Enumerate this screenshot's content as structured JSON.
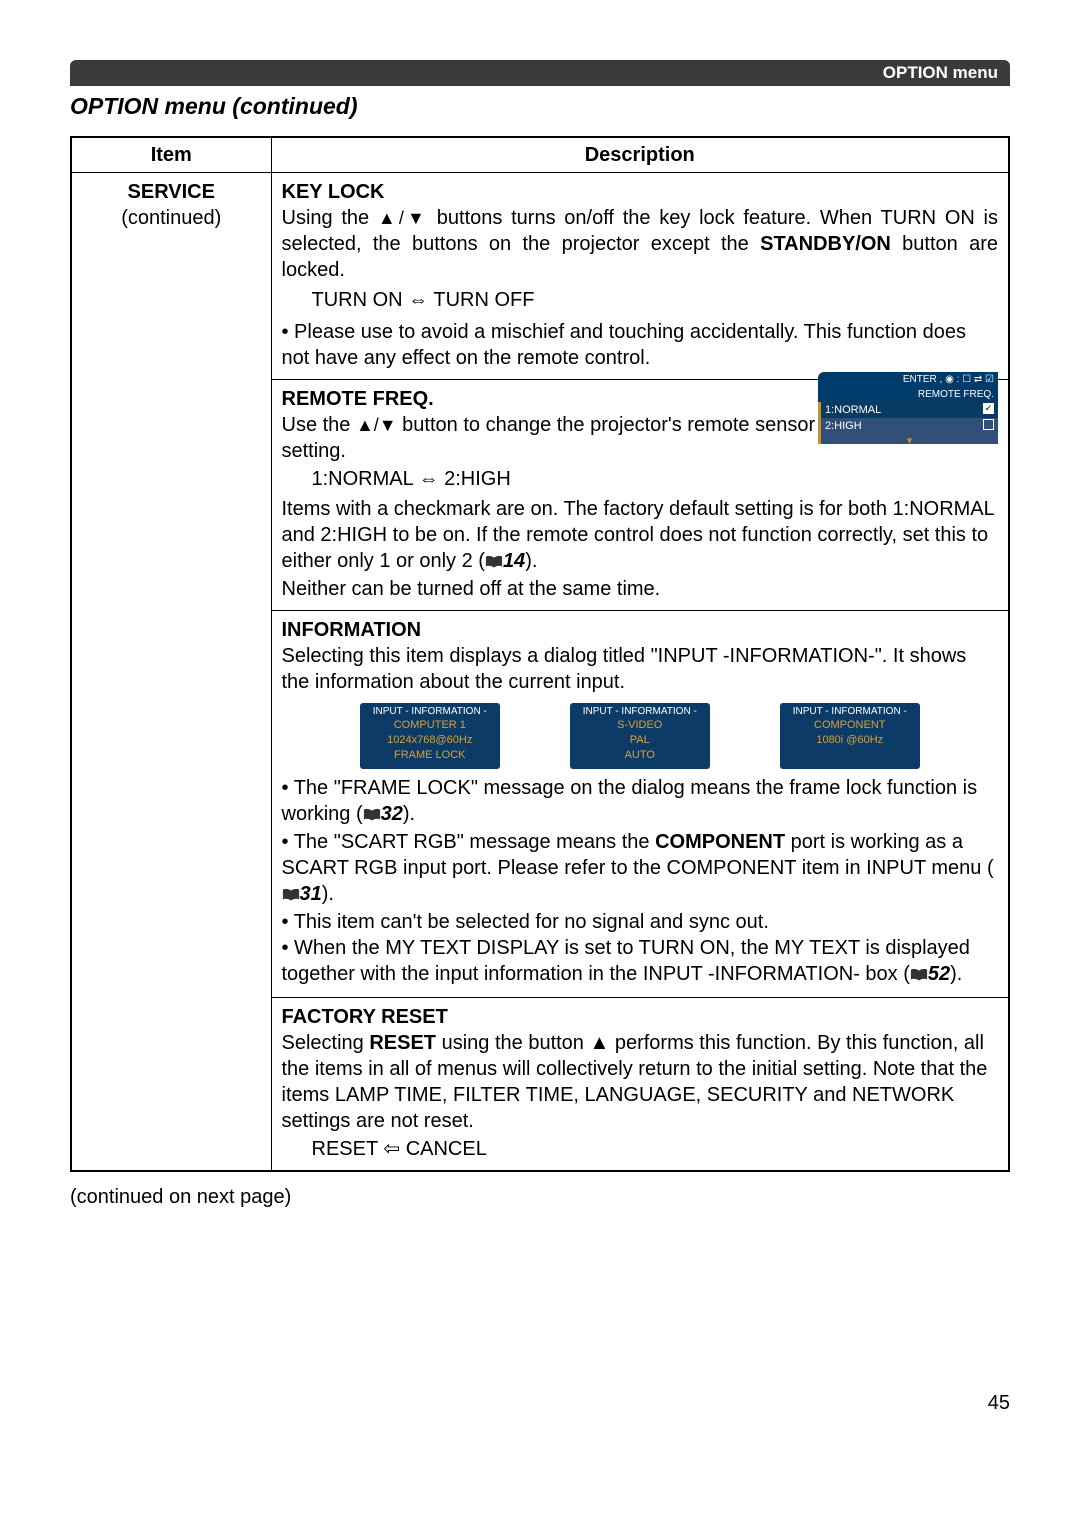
{
  "header": {
    "breadcrumb": "OPTION menu"
  },
  "page": {
    "title": "OPTION menu (continued)",
    "continued_note": "(continued on next page)",
    "number": "45"
  },
  "table": {
    "head_item": "Item",
    "head_desc": "Description",
    "item_label_1": "SERVICE",
    "item_label_2": "(continued)"
  },
  "keylock": {
    "title": "KEY LOCK",
    "p1a": "Using  the  ",
    "p1b": "  buttons  turns  on/off  the  key  lock  feature.  When TURN ON is selected, the buttons on the projector except the ",
    "p1c": "STANDBY/ON",
    "p1d": " button are locked.",
    "toggle_a": "TURN ON ",
    "toggle_b": " TURN OFF",
    "bullet": "• Please use to avoid a mischief and touching accidentally. This function does not have any effect on the remote control."
  },
  "remotefreq": {
    "title": "REMOTE FREQ.",
    "p1a": "Use the ",
    "p1b": " button to change the projector's remote sensor setting.",
    "toggle_a": "1:NORMAL ",
    "toggle_b": " 2:HIGH",
    "p2a": "Items with a checkmark are on. The factory default setting is for both 1:NORMAL and 2:HIGH to be on.  If the remote control does not function correctly, set this to either only 1 or only 2 (",
    "ref": "14",
    "p2b": ").",
    "p3": "Neither can be turned off at the same time.",
    "osd": {
      "hdr": "ENTER , ◉ : ☐ ⇄ ☑",
      "sub": "REMOTE FREQ.",
      "opt1": "1:NORMAL",
      "opt2": "2:HIGH"
    }
  },
  "information": {
    "title": "INFORMATION",
    "p1": "Selecting this item displays a dialog titled \"INPUT -INFORMATION-\". It shows the information about the current input.",
    "boxes": [
      {
        "t": "INPUT - INFORMATION -",
        "p1": "COMPUTER 1",
        "p2": "1024x768@60Hz",
        "p3": "FRAME LOCK"
      },
      {
        "t": "INPUT - INFORMATION -",
        "p1": "S-VIDEO",
        "p2": "PAL",
        "p3": "AUTO"
      },
      {
        "t": "INPUT - INFORMATION -",
        "p1": "COMPONENT",
        "p2": "1080i @60Hz",
        "p3": ""
      }
    ],
    "b1a": "• The \"FRAME LOCK\" message on the dialog means the frame lock function is working (",
    "ref1": "32",
    "b1b": ").",
    "b2a": "• The \"SCART RGB\" message means the ",
    "b2bold": "COMPONENT",
    "b2b": " port is working as a SCART RGB input port. Please refer to the COMPONENT item in INPUT menu (",
    "ref2": "31",
    "b2c": ").",
    "b3": "• This item can't be selected for no signal and sync out.",
    "b4a": "• When the MY TEXT DISPLAY is set to TURN ON, the MY TEXT is displayed together with the input information in the INPUT -INFORMATION- box (",
    "ref3": "52",
    "b4b": ")."
  },
  "factoryreset": {
    "title": "FACTORY RESET",
    "p1a": "Selecting ",
    "p1bold": "RESET",
    "p1b": " using the button ▲ performs this function. By this function, all the items in all of menus will collectively return to the initial setting. Note that the items LAMP TIME, FILTER TIME, LANGUAGE, SECURITY and NETWORK settings are not reset.",
    "toggle_a": "RESET ",
    "toggle_b": " CANCEL"
  },
  "glyphs": {
    "updown": "▲/▼",
    "lr": "⇔",
    "left": "⇦"
  }
}
